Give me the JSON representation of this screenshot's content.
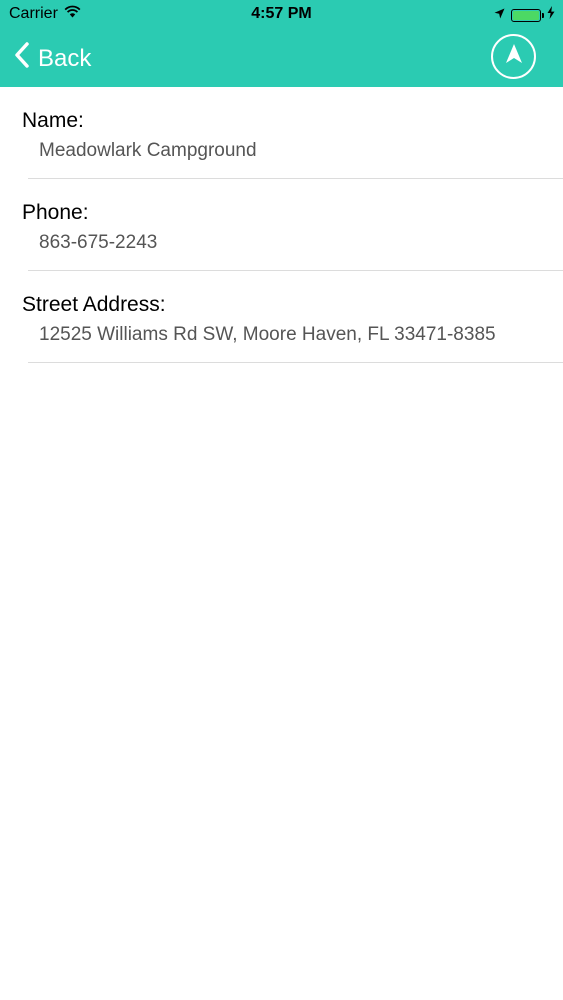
{
  "status_bar": {
    "carrier": "Carrier",
    "time": "4:57 PM",
    "wifi_icon": "wifi-icon",
    "location_icon": "location-arrow-icon",
    "battery_icon": "battery-icon",
    "charging_icon": "charging-bolt-icon",
    "battery_color": "#4cd964"
  },
  "nav": {
    "back_label": "Back",
    "back_icon": "chevron-left-icon",
    "navigate_icon": "navigation-arrow-icon",
    "background_color": "#2bcbb2"
  },
  "details": [
    {
      "label": "Name:",
      "value": "Meadowlark Campground"
    },
    {
      "label": "Phone:",
      "value": "863-675-2243"
    },
    {
      "label": "Street Address:",
      "value": "12525 Williams Rd SW, Moore Haven, FL 33471-8385"
    }
  ]
}
